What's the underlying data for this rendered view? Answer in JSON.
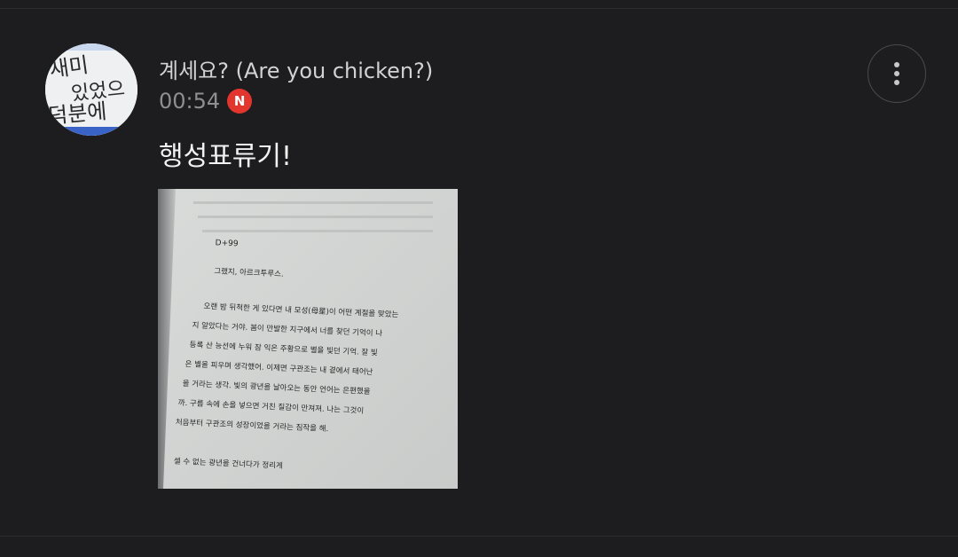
{
  "post": {
    "author_name": "계세요? (Are you chicken?)",
    "timestamp": "00:54",
    "new_badge": "N",
    "message": "행성표류기!",
    "avatar": {
      "handwriting": [
        "새미",
        "있었으",
        "덕분에"
      ]
    },
    "attachment": {
      "type": "photo of book page",
      "page_heading": "D+99",
      "lines": [
        "그랬지, 아르크투루스.",
        "오랜 밤 뒤척한 게 있다면 내 모성(母星)이 어떤 계절을 맞았는",
        "지 알았다는 거야. 봄이 만발한 지구에서 너를 찾던 기억이 나",
        "등록 산 능선에 누워 잠 익은 주황으로 별을 빛던 기억. 잘 빛",
        "은 별을 피우며 생각했어. 이제면 구관조는 내 곁에서 태어난",
        "을 거라는 생각. 빛의 광년을 날아오는 동안 언어는 은편했을",
        "까. 구름 속에 손을 넣으면 거친 질감이 만져져. 나는 그것이",
        "처음부터 구관조의 성장이었을 거라는 짐작을 해.",
        "셀 수 없는 광년을 건너다가 정리게"
      ]
    }
  },
  "colors": {
    "background": "#1d1d1f",
    "author_text": "#d2d2d2",
    "time_text": "#8e8e93",
    "badge": "#e2352e",
    "message_text": "#f2f2f2"
  },
  "icons": {
    "more": "vertical-ellipsis-icon",
    "new": "new-badge-icon"
  }
}
